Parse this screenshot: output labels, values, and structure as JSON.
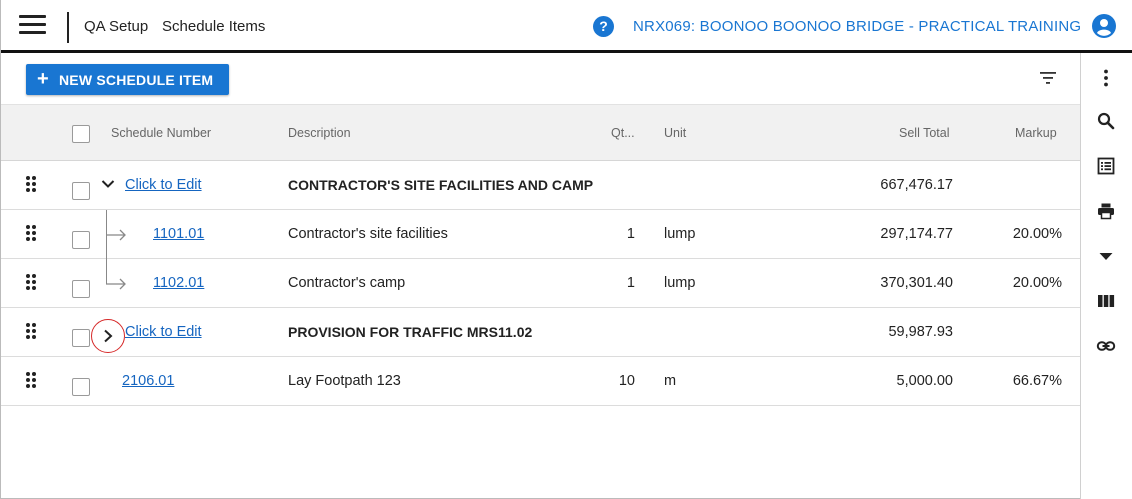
{
  "header": {
    "breadcrumb": [
      "QA Setup",
      "Schedule Items"
    ],
    "help_glyph": "?",
    "project_title": "NRX069: BOONOO BOONOO BRIDGE - PRACTICAL TRAINING"
  },
  "toolbar": {
    "new_button_icon": "+",
    "new_button_label": "NEW SCHEDULE ITEM"
  },
  "table": {
    "columns": {
      "schedule_number": "Schedule Number",
      "description": "Description",
      "qty": "Qt...",
      "unit": "Unit",
      "sell_total": "Sell Total",
      "markup": "Markup"
    },
    "rows": [
      {
        "number": "Click to Edit",
        "description": "CONTRACTOR'S SITE FACILITIES AND CAMP",
        "qty": "",
        "unit": "",
        "sell_total": "667,476.17",
        "markup": ""
      },
      {
        "number": "1101.01",
        "description": "Contractor's site facilities",
        "qty": "1",
        "unit": "lump",
        "sell_total": "297,174.77",
        "markup": "20.00%"
      },
      {
        "number": "1102.01",
        "description": "Contractor's camp",
        "qty": "1",
        "unit": "lump",
        "sell_total": "370,301.40",
        "markup": "20.00%"
      },
      {
        "number": "Click to Edit",
        "description": "PROVISION FOR TRAFFIC MRS11.02",
        "qty": "",
        "unit": "",
        "sell_total": "59,987.93",
        "markup": ""
      },
      {
        "number": "2106.01",
        "description": "Lay Footpath 123",
        "qty": "10",
        "unit": "m",
        "sell_total": "5,000.00",
        "markup": "66.67%"
      }
    ]
  },
  "icons": {
    "menu": "hamburger-icon",
    "help": "help-circle-icon",
    "user": "account-circle-icon",
    "filter": "filter-icon",
    "rail": [
      "more-vertical-icon",
      "search-icon",
      "list-icon",
      "print-icon",
      "dropdown-arrow-icon",
      "columns-icon",
      "link-icon"
    ]
  },
  "colors": {
    "accent": "#1976d2",
    "link": "#1565c0",
    "highlight_circle": "#d62828"
  }
}
